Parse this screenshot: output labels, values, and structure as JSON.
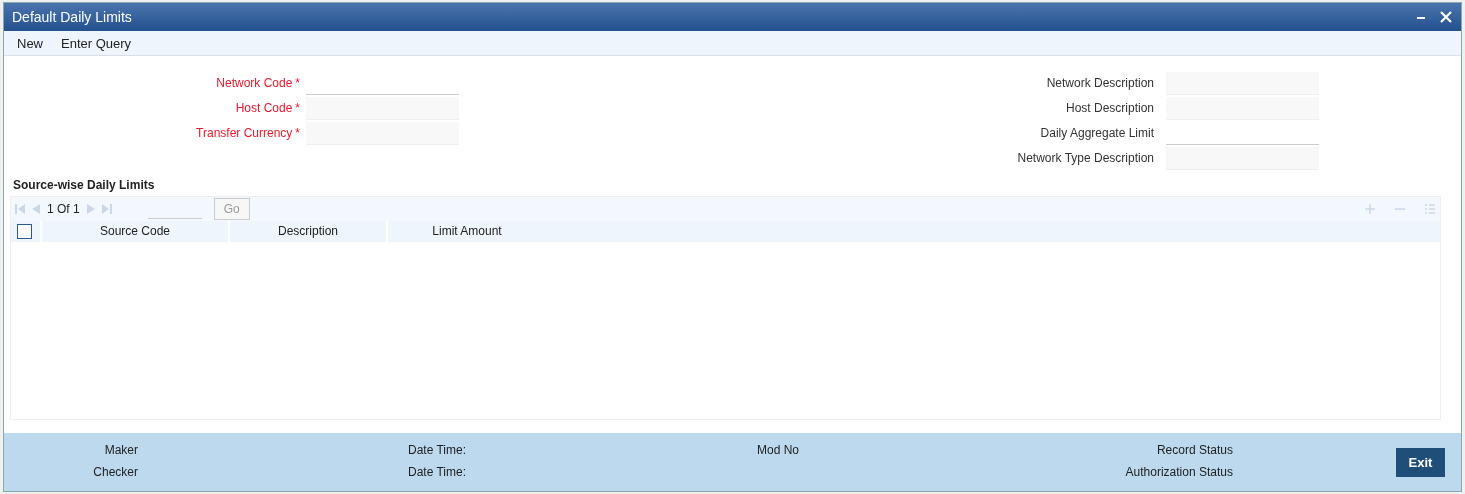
{
  "window": {
    "title": "Default Daily Limits"
  },
  "menu": [
    "New",
    "Enter Query"
  ],
  "form_left": [
    {
      "label": "Network Code",
      "required": true,
      "marker": "*",
      "disabled": false
    },
    {
      "label": "Host Code",
      "required": true,
      "marker": "*",
      "disabled": true
    },
    {
      "label": "Transfer Currency",
      "required": true,
      "marker": "*",
      "disabled": true
    }
  ],
  "form_right": [
    {
      "label": "Network Description",
      "disabled": true
    },
    {
      "label": "Host Description",
      "disabled": true
    },
    {
      "label": "Daily Aggregate Limit",
      "disabled": false
    },
    {
      "label": "Network Type Description",
      "disabled": true
    }
  ],
  "grid": {
    "title": "Source-wise Daily Limits",
    "page": "1",
    "of": "Of",
    "total": "1",
    "go": "Go",
    "select_all_checked": false,
    "columns": [
      "Source Code",
      "Description",
      "Limit Amount"
    ]
  },
  "footer": {
    "left": [
      {
        "label": "Maker"
      },
      {
        "label": "Checker"
      }
    ],
    "time": [
      {
        "label": "Date Time:"
      },
      {
        "label": "Date Time:"
      }
    ],
    "mod": [
      {
        "label": "Mod No"
      }
    ],
    "status": [
      {
        "label": "Record Status"
      },
      {
        "label": "Authorization Status"
      }
    ],
    "exit": "Exit"
  }
}
